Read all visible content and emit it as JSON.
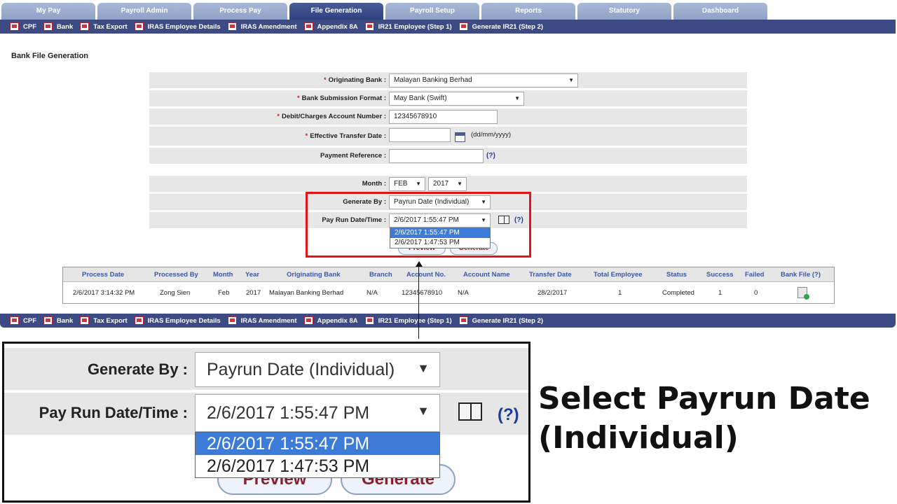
{
  "tabs": [
    "My Pay",
    "Payroll Admin",
    "Process Pay",
    "File Generation",
    "Payroll Setup",
    "Reports",
    "Statutory",
    "Dashboard"
  ],
  "active_tab": "File Generation",
  "subnav": [
    "CPF",
    "Bank",
    "Tax Export",
    "IRAS Employee Details",
    "IRAS Amendment",
    "Appendix 8A",
    "IR21 Employee (Step 1)",
    "Generate IR21 (Step 2)"
  ],
  "page_title": "Bank File Generation",
  "form": {
    "originating_bank_label": "Originating Bank :",
    "originating_bank_value": "Malayan Banking Berhad",
    "submission_format_label": "Bank Submission Format :",
    "submission_format_value": "May Bank (Swift)",
    "account_number_label": "Debit/Charges Account Number :",
    "account_number_value": "12345678910",
    "transfer_date_label": "Effective Transfer Date :",
    "transfer_date_value": "",
    "date_format_hint": "(dd/mm/yyyy)",
    "payment_reference_label": "Payment Reference :",
    "payment_reference_value": "",
    "help": "(?)",
    "month_label": "Month :",
    "month_value": "FEB",
    "year_value": "2017",
    "generate_by_label": "Generate By :",
    "generate_by_value": "Payrun Date (Individual)",
    "pay_run_label": "Pay Run Date/Time :",
    "pay_run_value": "2/6/2017 1:55:47 PM",
    "pay_run_options": [
      "2/6/2017 1:55:47 PM",
      "2/6/2017 1:47:53 PM"
    ],
    "preview_label": "Preview",
    "generate_label": "Generate"
  },
  "table": {
    "headers": [
      "Process Date",
      "Processed By",
      "Month",
      "Year",
      "Originating Bank",
      "Branch",
      "Account No.",
      "Account Name",
      "Transfer Date",
      "Total Employee",
      "Status",
      "Success",
      "Failed",
      "Bank File (?)"
    ],
    "row": [
      "2/6/2017 3:14:32 PM",
      "Zong Sien",
      "Feb",
      "2017",
      "Malayan Banking Berhad",
      "N/A",
      "12345678910",
      "N/A",
      "28/2/2017",
      "1",
      "Completed",
      "1",
      "0"
    ]
  },
  "caption": "Select Payrun Date (Individual)",
  "colors": {
    "nav": "#3d4b85",
    "highlight": "#e0141b",
    "selected": "#3d7bd9"
  }
}
